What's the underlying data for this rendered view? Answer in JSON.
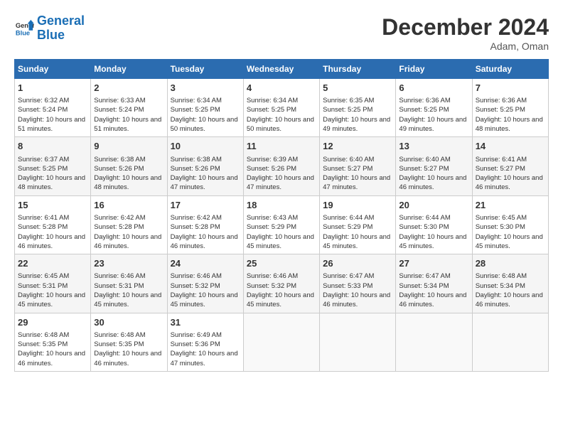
{
  "header": {
    "logo_line1": "General",
    "logo_line2": "Blue",
    "month_year": "December 2024",
    "location": "Adam, Oman"
  },
  "days_of_week": [
    "Sunday",
    "Monday",
    "Tuesday",
    "Wednesday",
    "Thursday",
    "Friday",
    "Saturday"
  ],
  "weeks": [
    [
      {
        "day": "1",
        "sunrise": "6:32 AM",
        "sunset": "5:24 PM",
        "daylight": "10 hours and 51 minutes."
      },
      {
        "day": "2",
        "sunrise": "6:33 AM",
        "sunset": "5:24 PM",
        "daylight": "10 hours and 51 minutes."
      },
      {
        "day": "3",
        "sunrise": "6:34 AM",
        "sunset": "5:25 PM",
        "daylight": "10 hours and 50 minutes."
      },
      {
        "day": "4",
        "sunrise": "6:34 AM",
        "sunset": "5:25 PM",
        "daylight": "10 hours and 50 minutes."
      },
      {
        "day": "5",
        "sunrise": "6:35 AM",
        "sunset": "5:25 PM",
        "daylight": "10 hours and 49 minutes."
      },
      {
        "day": "6",
        "sunrise": "6:36 AM",
        "sunset": "5:25 PM",
        "daylight": "10 hours and 49 minutes."
      },
      {
        "day": "7",
        "sunrise": "6:36 AM",
        "sunset": "5:25 PM",
        "daylight": "10 hours and 48 minutes."
      }
    ],
    [
      {
        "day": "8",
        "sunrise": "6:37 AM",
        "sunset": "5:25 PM",
        "daylight": "10 hours and 48 minutes."
      },
      {
        "day": "9",
        "sunrise": "6:38 AM",
        "sunset": "5:26 PM",
        "daylight": "10 hours and 48 minutes."
      },
      {
        "day": "10",
        "sunrise": "6:38 AM",
        "sunset": "5:26 PM",
        "daylight": "10 hours and 47 minutes."
      },
      {
        "day": "11",
        "sunrise": "6:39 AM",
        "sunset": "5:26 PM",
        "daylight": "10 hours and 47 minutes."
      },
      {
        "day": "12",
        "sunrise": "6:40 AM",
        "sunset": "5:27 PM",
        "daylight": "10 hours and 47 minutes."
      },
      {
        "day": "13",
        "sunrise": "6:40 AM",
        "sunset": "5:27 PM",
        "daylight": "10 hours and 46 minutes."
      },
      {
        "day": "14",
        "sunrise": "6:41 AM",
        "sunset": "5:27 PM",
        "daylight": "10 hours and 46 minutes."
      }
    ],
    [
      {
        "day": "15",
        "sunrise": "6:41 AM",
        "sunset": "5:28 PM",
        "daylight": "10 hours and 46 minutes."
      },
      {
        "day": "16",
        "sunrise": "6:42 AM",
        "sunset": "5:28 PM",
        "daylight": "10 hours and 46 minutes."
      },
      {
        "day": "17",
        "sunrise": "6:42 AM",
        "sunset": "5:28 PM",
        "daylight": "10 hours and 46 minutes."
      },
      {
        "day": "18",
        "sunrise": "6:43 AM",
        "sunset": "5:29 PM",
        "daylight": "10 hours and 45 minutes."
      },
      {
        "day": "19",
        "sunrise": "6:44 AM",
        "sunset": "5:29 PM",
        "daylight": "10 hours and 45 minutes."
      },
      {
        "day": "20",
        "sunrise": "6:44 AM",
        "sunset": "5:30 PM",
        "daylight": "10 hours and 45 minutes."
      },
      {
        "day": "21",
        "sunrise": "6:45 AM",
        "sunset": "5:30 PM",
        "daylight": "10 hours and 45 minutes."
      }
    ],
    [
      {
        "day": "22",
        "sunrise": "6:45 AM",
        "sunset": "5:31 PM",
        "daylight": "10 hours and 45 minutes."
      },
      {
        "day": "23",
        "sunrise": "6:46 AM",
        "sunset": "5:31 PM",
        "daylight": "10 hours and 45 minutes."
      },
      {
        "day": "24",
        "sunrise": "6:46 AM",
        "sunset": "5:32 PM",
        "daylight": "10 hours and 45 minutes."
      },
      {
        "day": "25",
        "sunrise": "6:46 AM",
        "sunset": "5:32 PM",
        "daylight": "10 hours and 45 minutes."
      },
      {
        "day": "26",
        "sunrise": "6:47 AM",
        "sunset": "5:33 PM",
        "daylight": "10 hours and 46 minutes."
      },
      {
        "day": "27",
        "sunrise": "6:47 AM",
        "sunset": "5:34 PM",
        "daylight": "10 hours and 46 minutes."
      },
      {
        "day": "28",
        "sunrise": "6:48 AM",
        "sunset": "5:34 PM",
        "daylight": "10 hours and 46 minutes."
      }
    ],
    [
      {
        "day": "29",
        "sunrise": "6:48 AM",
        "sunset": "5:35 PM",
        "daylight": "10 hours and 46 minutes."
      },
      {
        "day": "30",
        "sunrise": "6:48 AM",
        "sunset": "5:35 PM",
        "daylight": "10 hours and 46 minutes."
      },
      {
        "day": "31",
        "sunrise": "6:49 AM",
        "sunset": "5:36 PM",
        "daylight": "10 hours and 47 minutes."
      },
      null,
      null,
      null,
      null
    ]
  ]
}
